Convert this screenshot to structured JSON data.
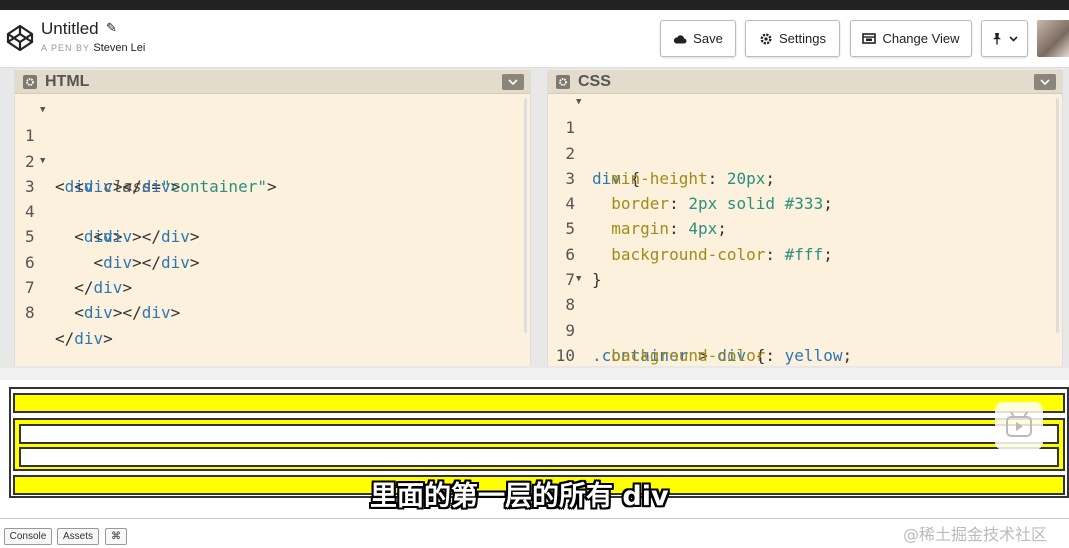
{
  "pen": {
    "title": "Untitled",
    "byline_prefix": "A PEN BY",
    "author": "Steven Lei"
  },
  "toolbar": {
    "save_label": "Save",
    "settings_label": "Settings",
    "change_view_label": "Change View"
  },
  "icons": {
    "logo": "codepen-logo-icon",
    "edit": "pencil-icon",
    "save": "cloud-icon",
    "settings": "gear-icon",
    "change_view": "view-icon",
    "pin": "pin-icon",
    "chevron": "chevron-down-icon"
  },
  "editors": {
    "html": {
      "title": "HTML",
      "lines": [
        {
          "n": "1",
          "fold": true
        },
        {
          "n": "2",
          "fold": false
        },
        {
          "n": "3",
          "fold": true
        },
        {
          "n": "4",
          "fold": false
        },
        {
          "n": "5",
          "fold": false
        },
        {
          "n": "6",
          "fold": false
        },
        {
          "n": "7",
          "fold": false
        },
        {
          "n": "8",
          "fold": false
        }
      ],
      "tokens": {
        "l1_open": "<",
        "l1_tag": "div",
        "l1_attr": "class",
        "l1_eq": "=",
        "l1_str": "\"container\"",
        "l1_close": ">",
        "l2_a": "<",
        "l2_b": "div",
        "l2_c": "></",
        "l2_d": "div",
        "l2_e": ">",
        "l3_a": "<",
        "l3_b": "div",
        "l3_c": ">",
        "l4_a": "<",
        "l4_b": "div",
        "l4_c": "></",
        "l4_d": "div",
        "l4_e": ">",
        "l5_a": "<",
        "l5_b": "div",
        "l5_c": "></",
        "l5_d": "div",
        "l5_e": ">",
        "l6_a": "</",
        "l6_b": "div",
        "l6_c": ">",
        "l7_a": "<",
        "l7_b": "div",
        "l7_c": "></",
        "l7_d": "div",
        "l7_e": ">",
        "l8_a": "</",
        "l8_b": "div",
        "l8_c": ">"
      }
    },
    "css": {
      "title": "CSS",
      "lines": [
        {
          "n": "1",
          "fold": true
        },
        {
          "n": "2",
          "fold": false
        },
        {
          "n": "3",
          "fold": false
        },
        {
          "n": "4",
          "fold": false
        },
        {
          "n": "5",
          "fold": false
        },
        {
          "n": "6",
          "fold": false
        },
        {
          "n": "7",
          "fold": false
        },
        {
          "n": "8",
          "fold": true
        },
        {
          "n": "9",
          "fold": false
        },
        {
          "n": "10",
          "fold": false
        }
      ],
      "tokens": {
        "l1_sel": "div",
        "l1_brace": " {",
        "l2_prop": "min-height",
        "l2_colon": ": ",
        "l2_val": "20px",
        "l2_semi": ";",
        "l3_prop": "border",
        "l3_colon": ": ",
        "l3_val1": "2px",
        "l3_val2": " solid #333",
        "l3_semi": ";",
        "l4_prop": "margin",
        "l4_colon": ": ",
        "l4_val": "4px",
        "l4_semi": ";",
        "l5_prop": "background-color",
        "l5_colon": ": ",
        "l5_val": "#fff",
        "l5_semi": ";",
        "l6_brace": "}",
        "l8_sel1": ".container",
        "l8_gt": " > ",
        "l8_sel2": "div",
        "l8_brace": " {",
        "l9_prop": "background-color",
        "l9_colon": ": ",
        "l9_val": "yellow",
        "l9_semi": ";",
        "l10_brace": "}"
      }
    }
  },
  "preview": {
    "subtitle": "里面的第一层的所有 div",
    "accent_yellow": "#ffff00",
    "border_color": "#333333"
  },
  "footer": {
    "console_label": "Console",
    "assets_label": "Assets",
    "shortcuts_label": "⌘",
    "watermark": "@稀土掘金技术社区"
  }
}
